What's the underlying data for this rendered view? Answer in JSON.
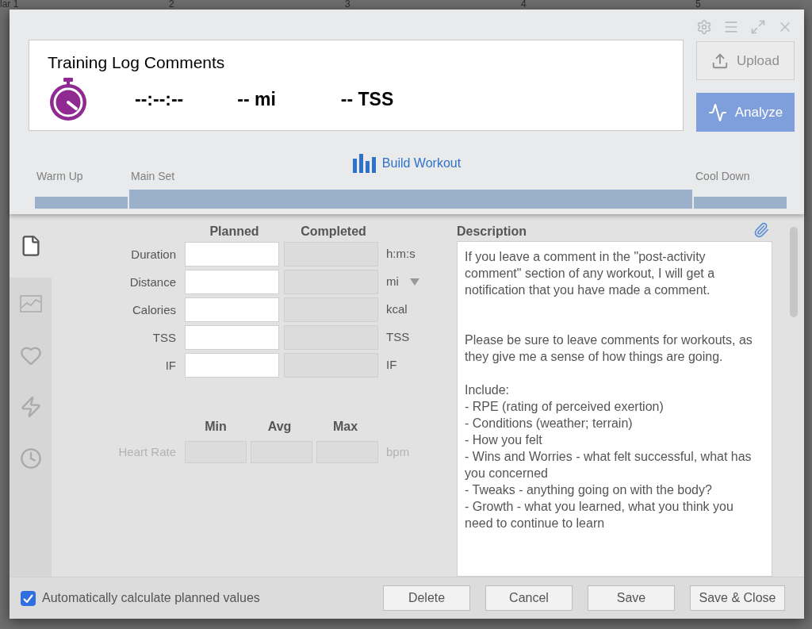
{
  "background_calendar": {
    "columns": [
      "lar 1",
      "2",
      "3",
      "4",
      "5"
    ]
  },
  "dialog": {
    "toolbar": [
      {
        "kind": "settings"
      },
      {
        "kind": "menu"
      },
      {
        "kind": "expand"
      },
      {
        "kind": "close"
      }
    ],
    "summary": {
      "title": "Training Log Comments",
      "duration": "--:--:--",
      "distance": "-- mi",
      "tss": "-- TSS"
    },
    "actions": [
      {
        "kind": "upload",
        "label": "Upload",
        "disabled": true
      },
      {
        "kind": "analyze",
        "label": "Analyze",
        "disabled": false
      }
    ],
    "workout": {
      "build_label": "Build Workout",
      "segments": [
        {
          "kind": "warmup",
          "label": "Warm Up"
        },
        {
          "kind": "main",
          "label": "Main Set"
        },
        {
          "kind": "cooldown",
          "label": "Cool Down"
        }
      ]
    },
    "sidebar": [
      {
        "kind": "document",
        "selected": true
      },
      {
        "kind": "chart",
        "selected": false
      },
      {
        "kind": "heart",
        "selected": false
      },
      {
        "kind": "bolt",
        "selected": false
      },
      {
        "kind": "clock",
        "selected": false
      }
    ],
    "form": {
      "columns": [
        "Planned",
        "Completed"
      ],
      "rows": [
        {
          "label": "Duration",
          "unit": "h:m:s",
          "dropdown": false
        },
        {
          "label": "Distance",
          "unit": "mi",
          "dropdown": true
        },
        {
          "label": "Calories",
          "unit": "kcal",
          "dropdown": false
        },
        {
          "label": "TSS",
          "unit": "TSS",
          "dropdown": false
        },
        {
          "label": "IF",
          "unit": "IF",
          "dropdown": false
        }
      ],
      "heart_rate": {
        "label": "Heart Rate",
        "unit": "bpm",
        "columns": [
          "Min",
          "Avg",
          "Max"
        ],
        "disabled": true
      }
    },
    "description": {
      "title": "Description",
      "text": "If you leave a comment in the \"post-activity comment\" section of any workout, I will get a notification that you have made a comment.\n\n\nPlease be sure to leave comments for workouts, as they give me a sense of how things are going.\n\nInclude:\n- RPE (rating of perceived exertion)\n- Conditions (weather; terrain)\n- How you felt\n- Wins and Worries - what felt successful, what has you concerned\n- Tweaks - anything going on with the body?\n- Growth - what you learned, what you think you need to continue to learn"
    },
    "footer": {
      "auto_calculate": {
        "label": "Automatically calculate planned values",
        "checked": true
      },
      "buttons": [
        "Delete",
        "Cancel",
        "Save",
        "Save & Close"
      ]
    }
  }
}
